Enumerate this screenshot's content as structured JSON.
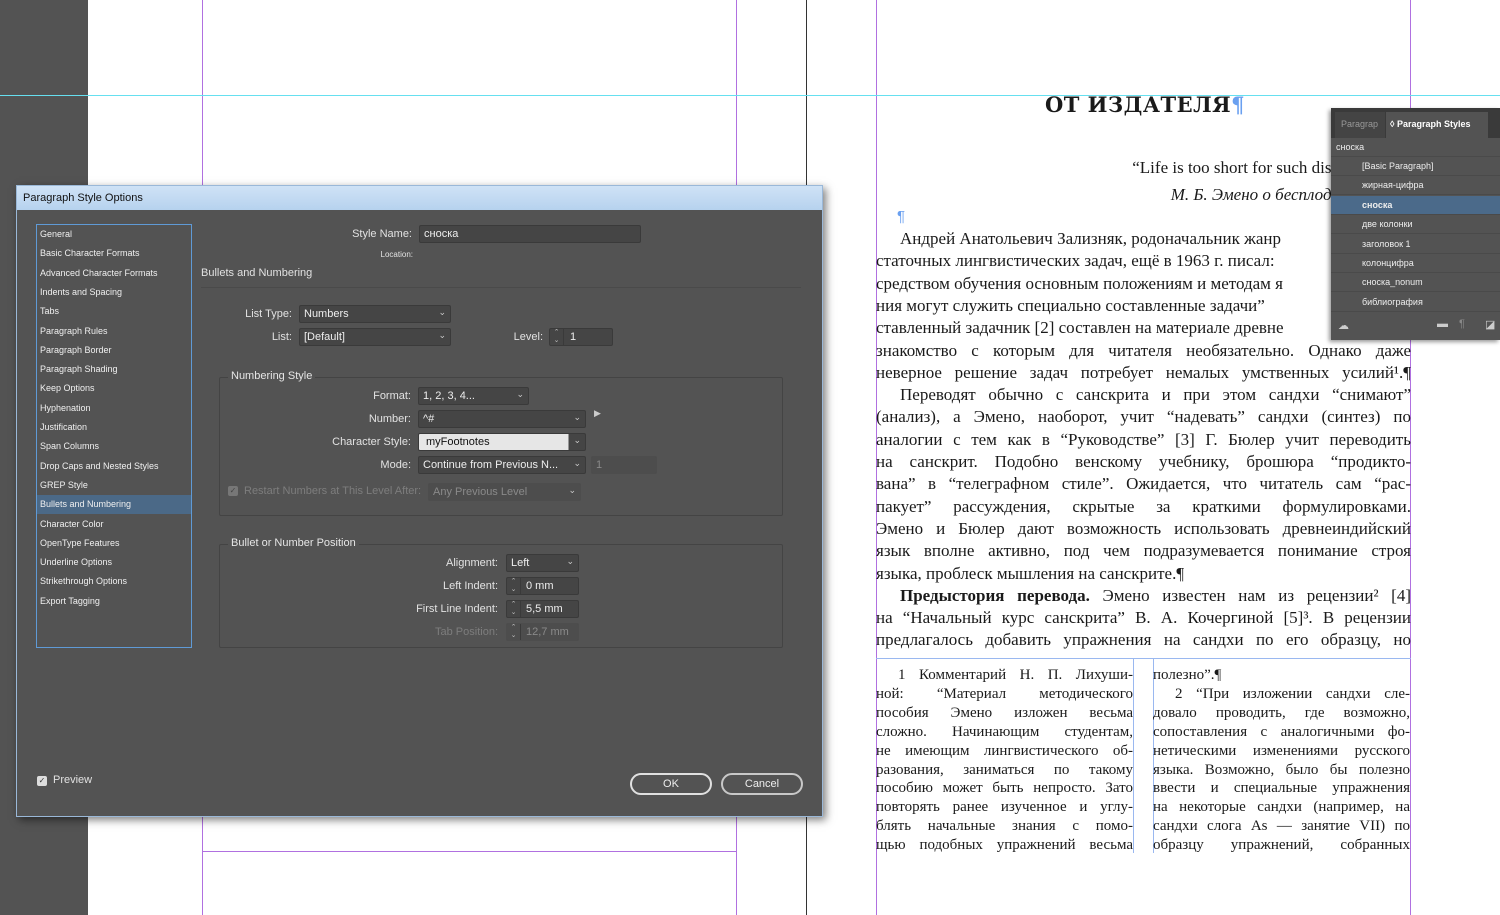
{
  "dialog": {
    "title": "Paragraph Style Options",
    "categories": [
      "General",
      "Basic Character Formats",
      "Advanced Character Formats",
      "Indents and Spacing",
      "Tabs",
      "Paragraph Rules",
      "Paragraph Border",
      "Paragraph Shading",
      "Keep Options",
      "Hyphenation",
      "Justification",
      "Span Columns",
      "Drop Caps and Nested Styles",
      "GREP Style",
      "Bullets and Numbering",
      "Character Color",
      "OpenType Features",
      "Underline Options",
      "Strikethrough Options",
      "Export Tagging"
    ],
    "selected_category": "Bullets and Numbering",
    "style_name_label": "Style Name:",
    "style_name_value": "сноска",
    "location_label": "Location:",
    "section_title": "Bullets and Numbering",
    "list_type_label": "List Type:",
    "list_type_value": "Numbers",
    "list_label": "List:",
    "list_value": "[Default]",
    "level_label": "Level:",
    "level_value": "1",
    "numbering_style": {
      "title": "Numbering Style",
      "format_label": "Format:",
      "format_value": "1, 2, 3, 4...",
      "number_label": "Number:",
      "number_value": "^#",
      "char_style_label": "Character Style:",
      "char_style_value": "myFootnotes",
      "mode_label": "Mode:",
      "mode_value": "Continue from Previous N...",
      "mode_start": "1",
      "restart_label": "Restart Numbers at This Level After:",
      "restart_checked": true,
      "restart_value": "Any Previous Level"
    },
    "position": {
      "title": "Bullet or Number Position",
      "alignment_label": "Alignment:",
      "alignment_value": "Left",
      "left_indent_label": "Left Indent:",
      "left_indent_value": "0 mm",
      "first_line_label": "First Line Indent:",
      "first_line_value": "5,5 mm",
      "tab_label": "Tab Position:",
      "tab_value": "12,7 mm"
    },
    "preview_label": "Preview",
    "preview_checked": true,
    "ok_label": "OK",
    "cancel_label": "Cancel"
  },
  "panel": {
    "tab_inactive": "Paragrap",
    "tab_active": "◊ Paragraph Styles",
    "current_style": "сноска",
    "styles": [
      "[Basic Paragraph]",
      "жирная-цифра",
      "сноска",
      "две колонки",
      "заголовок 1",
      "колонцифра",
      "сноска_nonum",
      "библиография"
    ],
    "selected_style": "сноска"
  },
  "document": {
    "title": "ОТ ИЗДАТЕЛЯ",
    "pilcrow": "¶",
    "quote": "“Life is too short for such disp",
    "attribution": "М. Б. Эмено о бесплодн",
    "body_lines": [
      {
        "t": "Андрей Анатольевич Зализняк, родоначальник жанр",
        "ind": true,
        "last": true
      },
      {
        "t": "статочных лингвистических задач, ещё в 1963 г. писал:",
        "last": true
      },
      {
        "t": "средством обучения основным положениям и методам я",
        "last": true
      },
      {
        "t": "ния могут служить специально составленные задачи”",
        "last": true
      },
      {
        "t": "ставленный задачник [2] составлен на материале древне",
        "last": true
      },
      {
        "t": "знакомство с которым для читателя необязательно. Однако даже"
      },
      {
        "t": "неверное решение задач потребует немалых умственных усилий¹.¶"
      },
      {
        "t": "Переводят обычно с санскрита и при этом сандхи “снимают”",
        "ind": true
      },
      {
        "t": "(анализ), а Эмено, наоборот, учит “надевать” сандхи (синтез) по"
      },
      {
        "t": "аналогии с тем как в “Руководстве” [3] Г. Бюлер учит переводить"
      },
      {
        "t": "на санскрит. Подобно венскому учебнику, брошюра “продикто-"
      },
      {
        "t": "вана” в “телеграфном стиле”. Ожидается, что читатель сам “рас-"
      },
      {
        "t": "пакует” рассуждения, скрытые за краткими формулировками."
      },
      {
        "t": "Эмено и Бюлер дают возможность использовать древнеиндийский"
      },
      {
        "t": "язык вполне активно, под чем подразумевается понимание строя"
      },
      {
        "t": "языка, проблеск мышления на санскрите.¶",
        "last": true
      },
      {
        "b": "Предыстория перевода.",
        "t": " Эмено известен нам из рецензии² [4]",
        "ind": true
      },
      {
        "t": "на “Начальный курс санскрита” В. А. Кочергиной [5]³. В рецензии"
      },
      {
        "t": "предлагалось добавить упражнения на сандхи по его образцу, но"
      }
    ],
    "footnotes_left": [
      {
        "t": "1 Комментарий Н. П. Лихуши-",
        "ind": true
      },
      {
        "t": "ной: “Материал методического"
      },
      {
        "t": "пособия Эмено изложен весьма"
      },
      {
        "t": "сложно. Начинающим студентам,"
      },
      {
        "t": "не имеющим лингвистического об-"
      },
      {
        "t": "разования, заниматься по такому"
      },
      {
        "t": "пособию может быть непросто. Зато"
      },
      {
        "t": "повторять ранее изученное и углу-"
      },
      {
        "t": "блять начальные знания с помо-"
      },
      {
        "t": "щью подобных упражнений весьма"
      }
    ],
    "footnotes_right": [
      {
        "t": "полезно”.¶",
        "last": true
      },
      {
        "t": "2 “При изложении сандхи сле-",
        "ind": true
      },
      {
        "t": "довало проводить, где возможно,"
      },
      {
        "t": "сопоставления с аналогичными фо-"
      },
      {
        "t": "нетическими изменениями русского"
      },
      {
        "t": "языка. Возможно, было бы полезно"
      },
      {
        "t": "ввести и специальные упражнения"
      },
      {
        "t": "на некоторые сандхи (например, на"
      },
      {
        "t": "сандхи слога As — занятие VII) по"
      },
      {
        "t": "образцу упражнений, собранных"
      }
    ]
  },
  "colors": {
    "guide_cyan": "#66e0f0",
    "margin_purple": "#a040e0",
    "selection_blue": "#4b6987",
    "dialog_bg": "#535353"
  }
}
